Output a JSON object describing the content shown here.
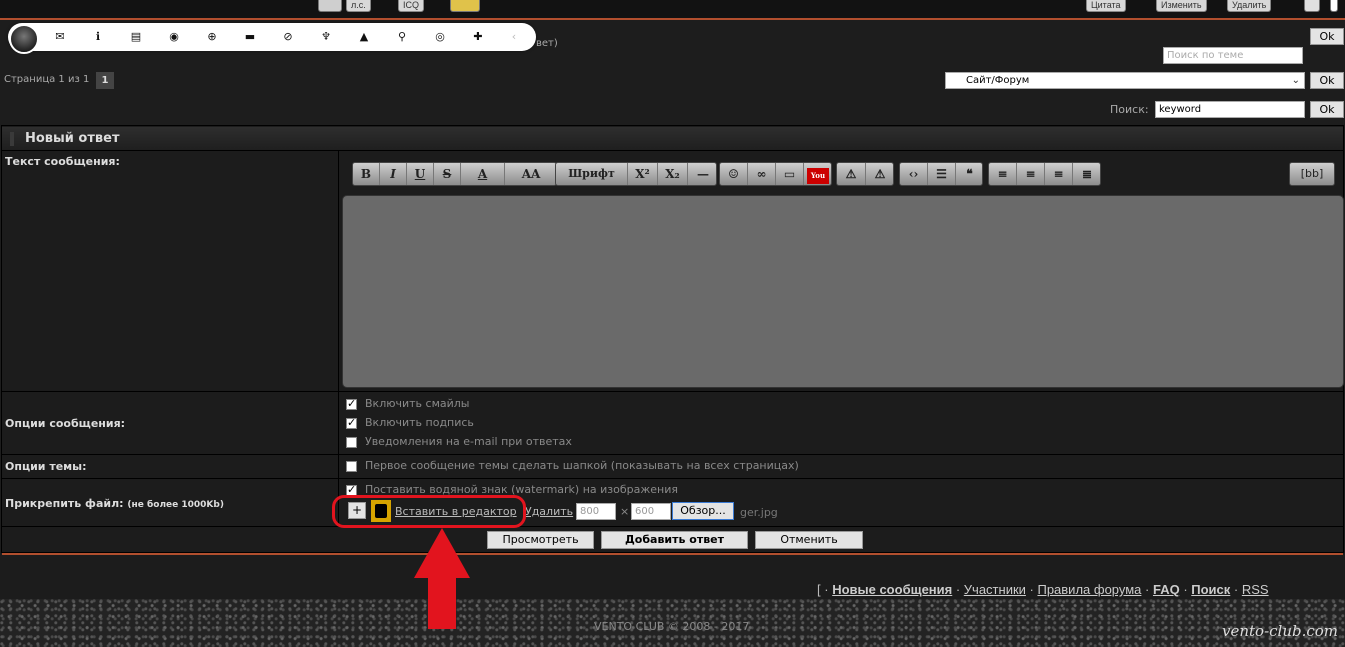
{
  "top": {
    "buttons": [
      "л.с.",
      "ICQ",
      "Цитата",
      "Изменить",
      "Удалить"
    ]
  },
  "floatbar": {
    "icons": [
      "envelope-icon",
      "info-icon",
      "bookmark-icon",
      "chat-icon",
      "plus-circle-icon",
      "folder-icon",
      "ban-icon",
      "trash-icon",
      "bell-icon",
      "search-icon",
      "eye-icon",
      "puzzle-icon",
      "chevron-left-icon"
    ],
    "behind_text": "вет)"
  },
  "search_topic": {
    "placeholder": "Поиск по теме",
    "ok": "Ok"
  },
  "pager": {
    "label": "Страница 1 из 1",
    "current": "1"
  },
  "forum_select": {
    "value": "Сайт/Форум",
    "ok": "Ok"
  },
  "search": {
    "label": "Поиск:",
    "value": "keyword",
    "ok": "Ok"
  },
  "panel": {
    "title": "Новый ответ",
    "message_label": "Текст сообщения:",
    "options_label": "Опции сообщения:",
    "topic_options_label": "Опции темы:",
    "attach_label": "Прикрепить файл:",
    "attach_note": "(не более 1000Kb)"
  },
  "editor": {
    "bold": "B",
    "italic": "I",
    "underline": "U",
    "strike": "S",
    "color": "A",
    "size": "AA",
    "font": "Шрифт",
    "sup": "X²",
    "sub": "X₂",
    "hr": "—",
    "bb": "[bb]"
  },
  "options": [
    {
      "label": "Включить смайлы",
      "checked": true
    },
    {
      "label": "Включить подпись",
      "checked": true
    },
    {
      "label": "Уведомления на e-mail при ответах",
      "checked": false
    }
  ],
  "topic_option": {
    "label": "Первое сообщение темы сделать шапкой (показывать на всех страницах)",
    "checked": false
  },
  "watermark_option": {
    "label": "Поставить водяной знак (watermark) на изображения",
    "checked": true
  },
  "attach": {
    "plus": "+",
    "insert_link": "Вставить в редактор",
    "delete_link": "Удалить",
    "width": "800",
    "times": "×",
    "height": "600",
    "browse": "Обзор...",
    "filename": "ger.jpg"
  },
  "actions": {
    "preview": "Просмотреть",
    "submit": "Добавить ответ",
    "cancel": "Отменить"
  },
  "footer": {
    "bracket": "[",
    "links": [
      "Новые сообщения",
      "Участники",
      "Правила форума",
      "FAQ",
      "Поиск",
      "RSS"
    ],
    "copyright": "VENTO CLUB © 2008 - 2017",
    "watermark": "vento-club.com"
  },
  "colors": {
    "accent_line": "#b24f2e",
    "highlight": "#e2141e"
  }
}
